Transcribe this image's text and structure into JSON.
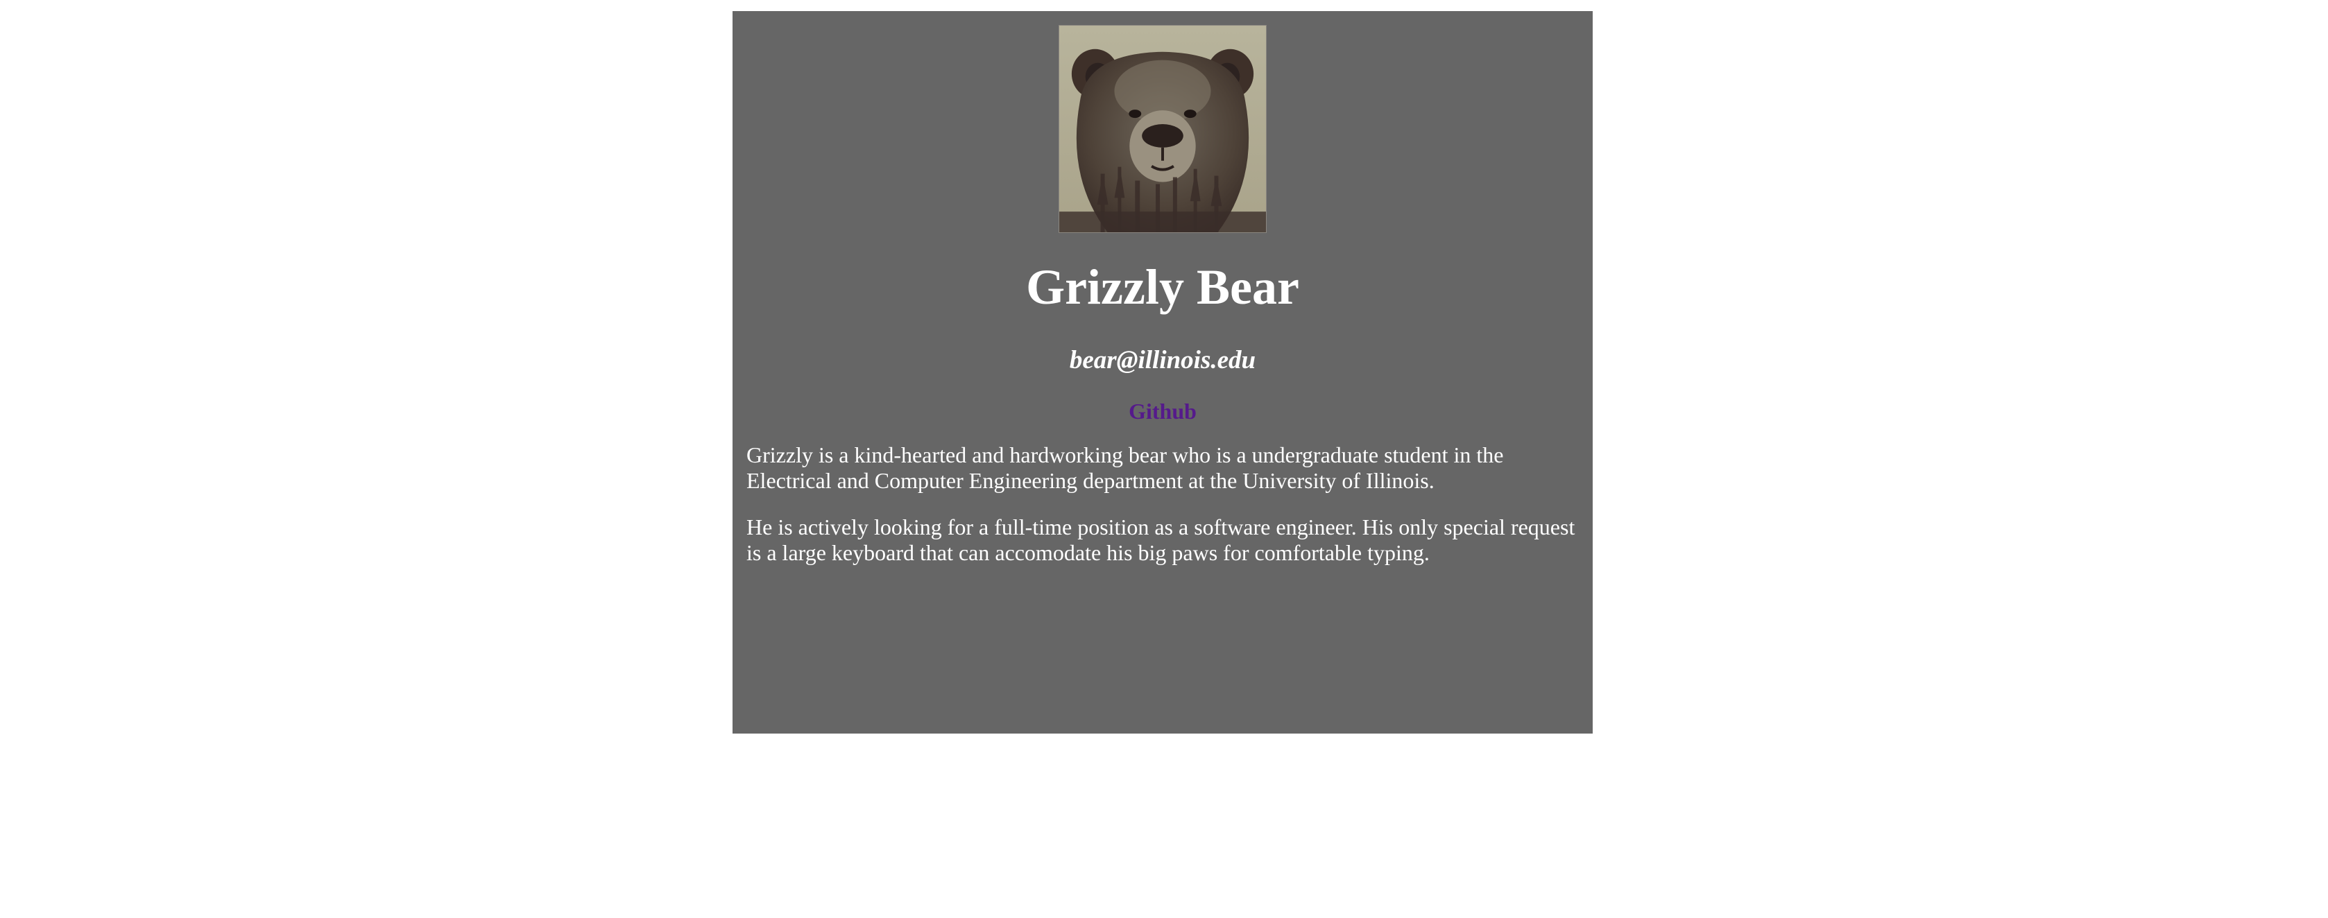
{
  "profile": {
    "photo_icon": "bear-portrait-image",
    "name": "Grizzly Bear",
    "email": "bear@illinois.edu",
    "link_label": "Github",
    "bio": [
      "Grizzly is a kind-hearted and hardworking bear who is a undergraduate student in the Electrical and Computer Engineering department at the University of Illinois.",
      "He is actively looking for a full-time position as a software engineer. His only special request is a large keyboard that can accomodate his big paws for comfortable typing."
    ]
  },
  "colors": {
    "card_background": "#666666",
    "text": "#ffffff",
    "link": "#551a8b",
    "page_background": "#ffffff"
  }
}
